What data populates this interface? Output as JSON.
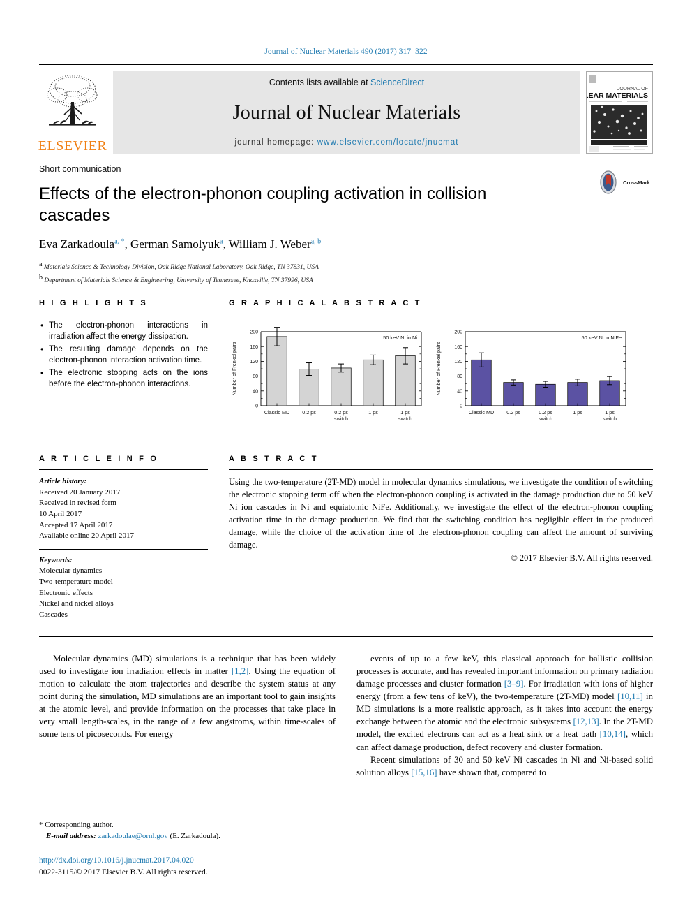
{
  "running_head": "Journal of Nuclear Materials 490 (2017) 317–322",
  "masthead": {
    "contents_prefix": "Contents lists available at",
    "sciencedirect": "ScienceDirect",
    "journal_title": "Journal of Nuclear Materials",
    "homepage_prefix": "journal homepage:",
    "homepage_url": "www.elsevier.com/locate/jnucmat",
    "publisher": "ELSEVIER",
    "cover": {
      "line1": "JOURNAL OF",
      "line2": "NUCLEAR MATERIALS"
    }
  },
  "article": {
    "kind": "Short communication",
    "title": "Effects of the electron-phonon coupling activation in collision cascades",
    "authors_parts": [
      {
        "name": "Eva Zarkadoula",
        "sup": "a, *"
      },
      {
        "name": "German Samolyuk",
        "sup": "a"
      },
      {
        "name": "William J. Weber",
        "sup": "a, b"
      }
    ],
    "affiliations": [
      {
        "mark": "a",
        "text": "Materials Science & Technology Division, Oak Ridge National Laboratory, Oak Ridge, TN 37831, USA"
      },
      {
        "mark": "b",
        "text": "Department of Materials Science & Engineering, University of Tennessee, Knoxville, TN 37996, USA"
      }
    ],
    "crossmark_label": "CrossMark"
  },
  "highlights": {
    "heading": "H I G H L I G H T S",
    "items": [
      "The electron-phonon interactions in irradiation affect the energy dissipation.",
      "The resulting damage depends on the electron-phonon interaction activation time.",
      "The electronic stopping acts on the ions before the electron-phonon interactions."
    ]
  },
  "graphical_abstract": {
    "heading": "G R A P H I C A L   A B S T R A C T"
  },
  "chart_data": [
    {
      "type": "bar",
      "title": "50 keV Ni in Ni",
      "ylabel": "Number of Frenkel pairs",
      "xlabel": "",
      "categories": [
        "Classic MD",
        "0.2 ps",
        "0.2 ps switch",
        "1 ps",
        "1 ps switch"
      ],
      "values": [
        187,
        99,
        102,
        124,
        135
      ],
      "errors": [
        25,
        17,
        11,
        13,
        22
      ],
      "ylim": [
        0,
        200
      ],
      "yticks": [
        0,
        40,
        80,
        120,
        160,
        200
      ],
      "bar_color": "#d4d4d4",
      "edge_color": "#000000",
      "grid": false,
      "legend": "none"
    },
    {
      "type": "bar",
      "title": "50 keV Ni in NiFe",
      "ylabel": "Number of Frenkel pairs",
      "xlabel": "",
      "categories": [
        "Classic MD",
        "0.2 ps",
        "0.2 ps switch",
        "1 ps",
        "1 ps switch"
      ],
      "values": [
        124,
        63,
        58,
        63,
        68
      ],
      "errors": [
        19,
        7,
        8,
        9,
        11
      ],
      "ylim": [
        0,
        200
      ],
      "yticks": [
        0,
        40,
        80,
        120,
        160,
        200
      ],
      "bar_color": "#5b52a3",
      "edge_color": "#000000",
      "grid": false,
      "legend": "none"
    }
  ],
  "article_info": {
    "heading": "A R T I C L E   I N F O",
    "history_label": "Article history:",
    "history": [
      "Received 20 January 2017",
      "Received in revised form",
      "10 April 2017",
      "Accepted 17 April 2017",
      "Available online 20 April 2017"
    ],
    "keywords_label": "Keywords:",
    "keywords": [
      "Molecular dynamics",
      "Two-temperature model",
      "Electronic effects",
      "Nickel and nickel alloys",
      "Cascades"
    ]
  },
  "abstract": {
    "heading": "A B S T R A C T",
    "text": "Using the two-temperature (2T-MD) model in molecular dynamics simulations, we investigate the condition of switching the electronic stopping term off when the electron-phonon coupling is activated in the damage production due to 50 keV Ni ion cascades in Ni and equiatomic NiFe. Additionally, we investigate the effect of the electron-phonon coupling activation time in the damage production. We find that the switching condition has negligible effect in the produced damage, while the choice of the activation time of the electron-phonon coupling can affect the amount of surviving damage.",
    "copyright": "© 2017 Elsevier B.V. All rights reserved."
  },
  "body": {
    "left_col_html": "Molecular dynamics (MD) simulations is a technique that has been widely used to investigate ion irradiation effects in matter <span class=\"ref\">[1,2]</span>. Using the equation of motion to calculate the atom trajectories and describe the system status at any point during the simulation, MD simulations are an important tool to gain insights at the atomic level, and provide information on the processes that take place in very small length-scales, in the range of a few angstroms, within time-scales of some tens of picoseconds. For energy",
    "right_col_html": "events of up to a few keV, this classical approach for ballistic collision processes is accurate, and has revealed important information on primary radiation damage processes and cluster formation <span class=\"ref\">[3–9]</span>. For irradiation with ions of higher energy (from a few tens of keV), the two-temperature (2T-MD) model <span class=\"ref\">[10,11]</span> in MD simulations is a more realistic approach, as it takes into account the energy exchange between the atomic and the electronic subsystems <span class=\"ref\">[12,13]</span>. In the 2T-MD model, the excited electrons can act as a heat sink or a heat bath <span class=\"ref\">[10,14]</span>, which can affect damage production, defect recovery and cluster formation.",
    "right_col_html_2": "Recent simulations of 30 and 50 keV Ni cascades in Ni and Ni-based solid solution alloys <span class=\"ref\">[15,16]</span> have shown that, compared to"
  },
  "footnotes": {
    "corresponding": "* Corresponding author.",
    "email_label": "E-mail address:",
    "email": "zarkadoulae@ornl.gov",
    "email_suffix": "(E. Zarkadoula).",
    "doi": "http://dx.doi.org/10.1016/j.jnucmat.2017.04.020",
    "issn_line": "0022-3115/© 2017 Elsevier B.V. All rights reserved."
  }
}
